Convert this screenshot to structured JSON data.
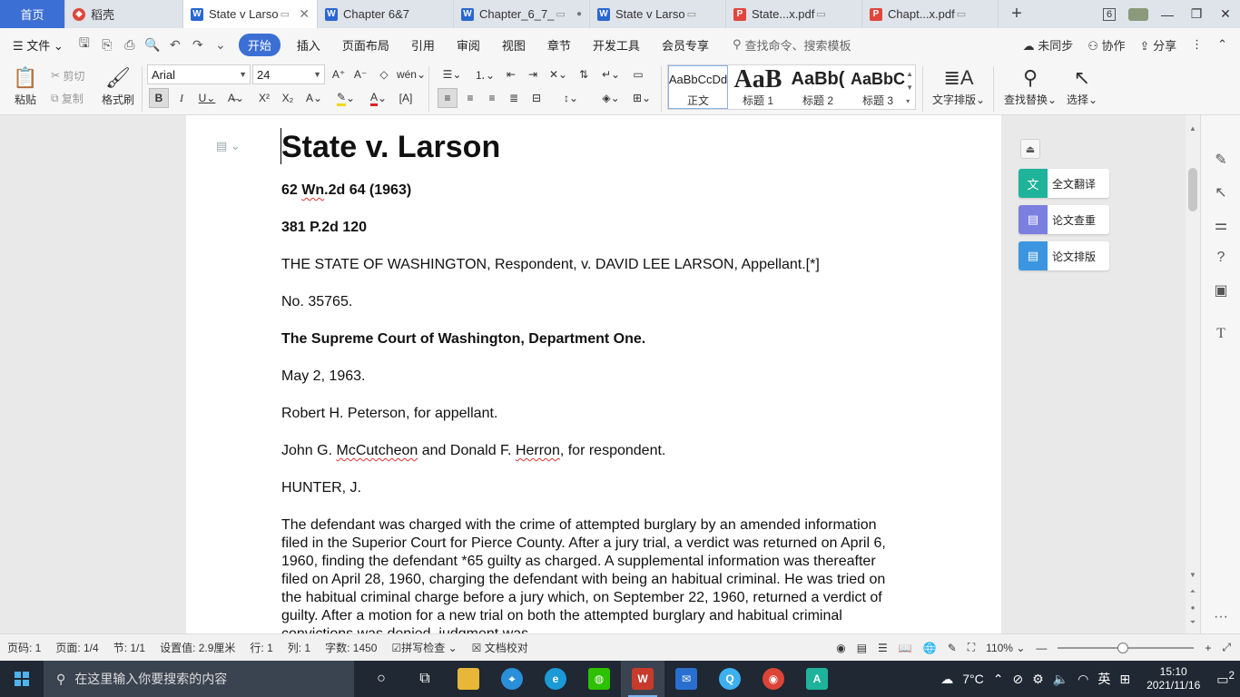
{
  "tabs": [
    {
      "label": "首页",
      "kind": "home"
    },
    {
      "label": "稻壳",
      "kind": "docer"
    },
    {
      "label": "State v Larso",
      "kind": "word",
      "active": true
    },
    {
      "label": "Chapter 6&7",
      "kind": "word"
    },
    {
      "label": "Chapter_6_7_",
      "kind": "word"
    },
    {
      "label": "State v Larso",
      "kind": "word"
    },
    {
      "label": "State...x.pdf",
      "kind": "pdf"
    },
    {
      "label": "Chapt...x.pdf",
      "kind": "pdf"
    }
  ],
  "tabbar_right": {
    "window_count": "6"
  },
  "menu": {
    "file": "文件",
    "items": [
      "开始",
      "插入",
      "页面布局",
      "引用",
      "审阅",
      "视图",
      "章节",
      "开发工具",
      "会员专享"
    ],
    "search_placeholder": "查找命令、搜索模板",
    "sync": "未同步",
    "collab": "协作",
    "share": "分享"
  },
  "ribbon": {
    "paste": "粘贴",
    "cut": "剪切",
    "copy": "复制",
    "format_painter": "格式刷",
    "font_name": "Arial",
    "font_size": "24",
    "styles": [
      {
        "preview": "AaBbCcDd",
        "label": "正文"
      },
      {
        "preview": "AaB",
        "label": "标题 1"
      },
      {
        "preview": "AaBb(",
        "label": "标题 2"
      },
      {
        "preview": "AaBbC",
        "label": "标题 3"
      }
    ],
    "text_layout": "文字排版",
    "find_replace": "查找替换",
    "select": "选择"
  },
  "document": {
    "title": "State v. Larson",
    "cite1_a": "62 ",
    "cite1_b": "Wn",
    "cite1_c": ".2d 64 (1963)",
    "cite2": "381 P.2d 120",
    "parties": "THE STATE OF WASHINGTON, Respondent, v. DAVID LEE LARSON, Appellant.[*]",
    "docket": "No. 35765.",
    "court": "The Supreme Court of Washington, Department One.",
    "date": "May 2, 1963.",
    "counsel1": "Robert H. Peterson, for appellant.",
    "counsel2_a": "John G. ",
    "counsel2_b": "McCutcheon",
    "counsel2_c": " and Donald F. ",
    "counsel2_d": "Herron",
    "counsel2_e": ", for respondent.",
    "judge": "HUNTER, J.",
    "body": "The defendant was charged with the crime of attempted burglary by an amended information filed in the Superior Court for Pierce County. After a jury trial, a verdict was returned on April 6, 1960, finding the defendant *65 guilty as charged. A supplemental information was thereafter filed on April 28, 1960, charging the defendant with being an habitual criminal. He was tried on the habitual criminal charge before a jury which, on September 22, 1960, returned a verdict of guilty. After a motion for a new trial on both the attempted burglary and habitual criminal convictions was denied, judgment was"
  },
  "side_panel": [
    {
      "label": "全文翻译",
      "color": "#1fb39b"
    },
    {
      "label": "论文查重",
      "color": "#7b7fe0"
    },
    {
      "label": "论文排版",
      "color": "#3c95e0"
    }
  ],
  "status": {
    "page_no": "页码: 1",
    "pages": "页面: 1/4",
    "section": "节: 1/1",
    "setting": "设置值: 2.9厘米",
    "row": "行: 1",
    "col": "列: 1",
    "words": "字数: 1450",
    "spell": "拼写检查",
    "proof": "文档校对",
    "zoom": "110%"
  },
  "taskbar": {
    "search_placeholder": "在这里输入你要搜索的内容",
    "weather": "7°C",
    "ime": "英",
    "time": "15:10",
    "date": "2021/11/16",
    "notif_count": "2"
  }
}
